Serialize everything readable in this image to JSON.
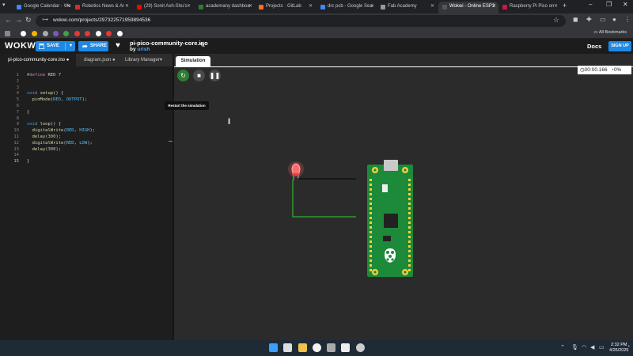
{
  "browser": {
    "tabs": [
      {
        "title": "Google Calendar - We",
        "color": "#4285f4"
      },
      {
        "title": "Robotics News & Ar",
        "color": "#d32f2f"
      },
      {
        "title": "(29) Sonit Ash-Shu's",
        "color": "#ff0000"
      },
      {
        "title": "academany dashboa",
        "color": "#2e7d32"
      },
      {
        "title": "Projects · GitLab",
        "color": "#fc6d26"
      },
      {
        "title": "drc pcb - Google Sea",
        "color": "#4285f4"
      },
      {
        "title": "Fab Academy",
        "color": "#999999"
      },
      {
        "title": "Wokwi - Online ESP3",
        "color": "#555555"
      },
      {
        "title": "Raspberry Pi Pico on",
        "color": "#c51a4a"
      }
    ],
    "url": "wokwi.com/projects/297322571959894536",
    "all_bookmarks": "All Bookmarks"
  },
  "wokwi": {
    "logo": "WOKWI",
    "save": "SAVE",
    "share": "SHARE",
    "project_name": "pi-pico-community-core.ino",
    "by": "by",
    "author": "urish",
    "docs": "Docs",
    "signup": "SIGN UP"
  },
  "editor": {
    "tabs": [
      {
        "label": "pi-pico-community-core.ino ●"
      },
      {
        "label": "diagram.json ●"
      },
      {
        "label": "Library Manager"
      }
    ],
    "lines": [
      {
        "n": "1",
        "text": "#define RED 7"
      },
      {
        "n": "2",
        "text": ""
      },
      {
        "n": "3",
        "text": ""
      },
      {
        "n": "4",
        "text": "void setup() {"
      },
      {
        "n": "5",
        "text": "  pinMode(RED, OUTPUT);"
      },
      {
        "n": "6",
        "text": ""
      },
      {
        "n": "7",
        "text": "}"
      },
      {
        "n": "8",
        "text": ""
      },
      {
        "n": "9",
        "text": "void loop() {"
      },
      {
        "n": "10",
        "text": "  digitalWrite(RED, HIGH);"
      },
      {
        "n": "11",
        "text": "  delay(300);"
      },
      {
        "n": "12",
        "text": "  digitalWrite(RED, LOW);"
      },
      {
        "n": "13",
        "text": "  delay(300);"
      },
      {
        "n": "14",
        "text": ""
      },
      {
        "n": "15",
        "text": "}"
      }
    ]
  },
  "simulation": {
    "tab": "Simulation",
    "tooltip": "Restart the simulation",
    "timer": "00:00.166",
    "cpu": "0%"
  },
  "taskbar": {
    "time": "2:32 PM",
    "date": "4/26/2025"
  }
}
